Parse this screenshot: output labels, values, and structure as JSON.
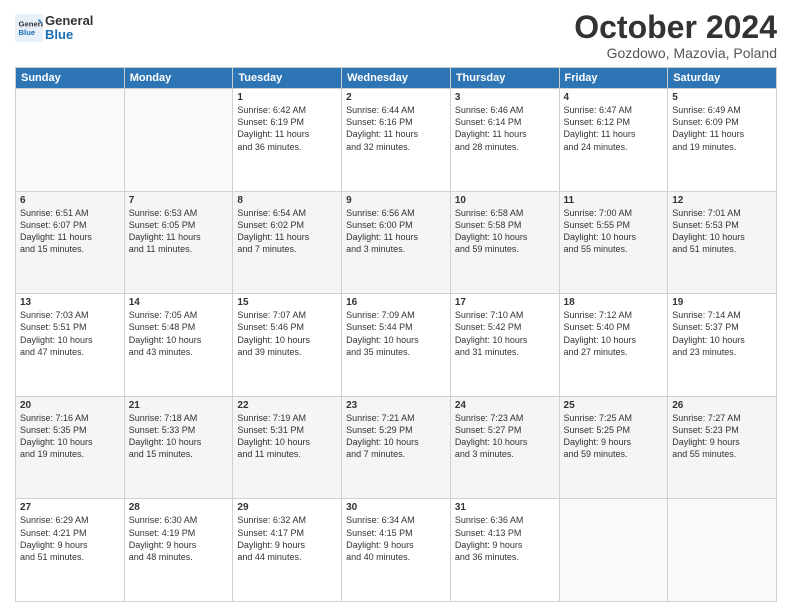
{
  "header": {
    "logo_line1": "General",
    "logo_line2": "Blue",
    "month_title": "October 2024",
    "location": "Gozdowo, Mazovia, Poland"
  },
  "weekdays": [
    "Sunday",
    "Monday",
    "Tuesday",
    "Wednesday",
    "Thursday",
    "Friday",
    "Saturday"
  ],
  "weeks": [
    [
      {
        "day": "",
        "content": ""
      },
      {
        "day": "",
        "content": ""
      },
      {
        "day": "1",
        "content": "Sunrise: 6:42 AM\nSunset: 6:19 PM\nDaylight: 11 hours\nand 36 minutes."
      },
      {
        "day": "2",
        "content": "Sunrise: 6:44 AM\nSunset: 6:16 PM\nDaylight: 11 hours\nand 32 minutes."
      },
      {
        "day": "3",
        "content": "Sunrise: 6:46 AM\nSunset: 6:14 PM\nDaylight: 11 hours\nand 28 minutes."
      },
      {
        "day": "4",
        "content": "Sunrise: 6:47 AM\nSunset: 6:12 PM\nDaylight: 11 hours\nand 24 minutes."
      },
      {
        "day": "5",
        "content": "Sunrise: 6:49 AM\nSunset: 6:09 PM\nDaylight: 11 hours\nand 19 minutes."
      }
    ],
    [
      {
        "day": "6",
        "content": "Sunrise: 6:51 AM\nSunset: 6:07 PM\nDaylight: 11 hours\nand 15 minutes."
      },
      {
        "day": "7",
        "content": "Sunrise: 6:53 AM\nSunset: 6:05 PM\nDaylight: 11 hours\nand 11 minutes."
      },
      {
        "day": "8",
        "content": "Sunrise: 6:54 AM\nSunset: 6:02 PM\nDaylight: 11 hours\nand 7 minutes."
      },
      {
        "day": "9",
        "content": "Sunrise: 6:56 AM\nSunset: 6:00 PM\nDaylight: 11 hours\nand 3 minutes."
      },
      {
        "day": "10",
        "content": "Sunrise: 6:58 AM\nSunset: 5:58 PM\nDaylight: 10 hours\nand 59 minutes."
      },
      {
        "day": "11",
        "content": "Sunrise: 7:00 AM\nSunset: 5:55 PM\nDaylight: 10 hours\nand 55 minutes."
      },
      {
        "day": "12",
        "content": "Sunrise: 7:01 AM\nSunset: 5:53 PM\nDaylight: 10 hours\nand 51 minutes."
      }
    ],
    [
      {
        "day": "13",
        "content": "Sunrise: 7:03 AM\nSunset: 5:51 PM\nDaylight: 10 hours\nand 47 minutes."
      },
      {
        "day": "14",
        "content": "Sunrise: 7:05 AM\nSunset: 5:48 PM\nDaylight: 10 hours\nand 43 minutes."
      },
      {
        "day": "15",
        "content": "Sunrise: 7:07 AM\nSunset: 5:46 PM\nDaylight: 10 hours\nand 39 minutes."
      },
      {
        "day": "16",
        "content": "Sunrise: 7:09 AM\nSunset: 5:44 PM\nDaylight: 10 hours\nand 35 minutes."
      },
      {
        "day": "17",
        "content": "Sunrise: 7:10 AM\nSunset: 5:42 PM\nDaylight: 10 hours\nand 31 minutes."
      },
      {
        "day": "18",
        "content": "Sunrise: 7:12 AM\nSunset: 5:40 PM\nDaylight: 10 hours\nand 27 minutes."
      },
      {
        "day": "19",
        "content": "Sunrise: 7:14 AM\nSunset: 5:37 PM\nDaylight: 10 hours\nand 23 minutes."
      }
    ],
    [
      {
        "day": "20",
        "content": "Sunrise: 7:16 AM\nSunset: 5:35 PM\nDaylight: 10 hours\nand 19 minutes."
      },
      {
        "day": "21",
        "content": "Sunrise: 7:18 AM\nSunset: 5:33 PM\nDaylight: 10 hours\nand 15 minutes."
      },
      {
        "day": "22",
        "content": "Sunrise: 7:19 AM\nSunset: 5:31 PM\nDaylight: 10 hours\nand 11 minutes."
      },
      {
        "day": "23",
        "content": "Sunrise: 7:21 AM\nSunset: 5:29 PM\nDaylight: 10 hours\nand 7 minutes."
      },
      {
        "day": "24",
        "content": "Sunrise: 7:23 AM\nSunset: 5:27 PM\nDaylight: 10 hours\nand 3 minutes."
      },
      {
        "day": "25",
        "content": "Sunrise: 7:25 AM\nSunset: 5:25 PM\nDaylight: 9 hours\nand 59 minutes."
      },
      {
        "day": "26",
        "content": "Sunrise: 7:27 AM\nSunset: 5:23 PM\nDaylight: 9 hours\nand 55 minutes."
      }
    ],
    [
      {
        "day": "27",
        "content": "Sunrise: 6:29 AM\nSunset: 4:21 PM\nDaylight: 9 hours\nand 51 minutes."
      },
      {
        "day": "28",
        "content": "Sunrise: 6:30 AM\nSunset: 4:19 PM\nDaylight: 9 hours\nand 48 minutes."
      },
      {
        "day": "29",
        "content": "Sunrise: 6:32 AM\nSunset: 4:17 PM\nDaylight: 9 hours\nand 44 minutes."
      },
      {
        "day": "30",
        "content": "Sunrise: 6:34 AM\nSunset: 4:15 PM\nDaylight: 9 hours\nand 40 minutes."
      },
      {
        "day": "31",
        "content": "Sunrise: 6:36 AM\nSunset: 4:13 PM\nDaylight: 9 hours\nand 36 minutes."
      },
      {
        "day": "",
        "content": ""
      },
      {
        "day": "",
        "content": ""
      }
    ]
  ]
}
